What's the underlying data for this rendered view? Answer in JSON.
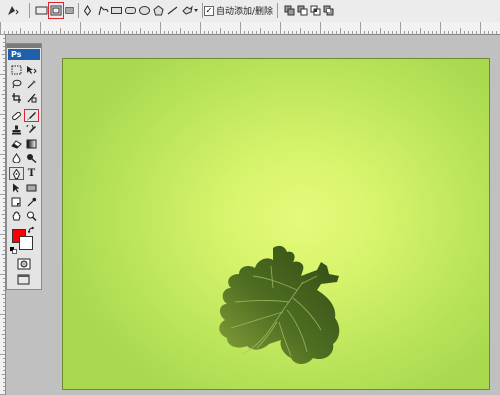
{
  "options_bar": {
    "auto_add_delete_label": "自动添加/删除",
    "auto_add_delete_checked": "✓"
  },
  "toolbox": {
    "badge": "Ps",
    "type_tool_glyph": "T"
  },
  "colors": {
    "foreground": "#ff0000",
    "background": "#ffffff",
    "highlight": "#e0252f",
    "artboard_center": "#e5fa7a",
    "artboard_edge": "#a8d94f",
    "leaf": "#4d6a22"
  },
  "icons": [
    "pen-tool-icon",
    "freeform-pen-icon",
    "rectangle-icon",
    "rounded-rectangle-icon",
    "ellipse-icon",
    "polygon-icon",
    "line-icon",
    "custom-shape-icon",
    "path-mode-icon",
    "shape-layers-icon",
    "fill-pixels-icon",
    "marquee-icon",
    "move-icon",
    "lasso-icon",
    "magic-wand-icon",
    "crop-icon",
    "slice-icon",
    "healing-brush-icon",
    "brush-icon",
    "clone-stamp-icon",
    "history-brush-icon",
    "eraser-icon",
    "gradient-icon",
    "blur-icon",
    "dodge-icon",
    "type-icon",
    "path-selection-icon",
    "rectangle-shape-icon",
    "notes-icon",
    "eyedropper-icon",
    "hand-icon",
    "zoom-icon",
    "quick-mask-icon",
    "screen-mode-icon",
    "leaf-shape"
  ]
}
